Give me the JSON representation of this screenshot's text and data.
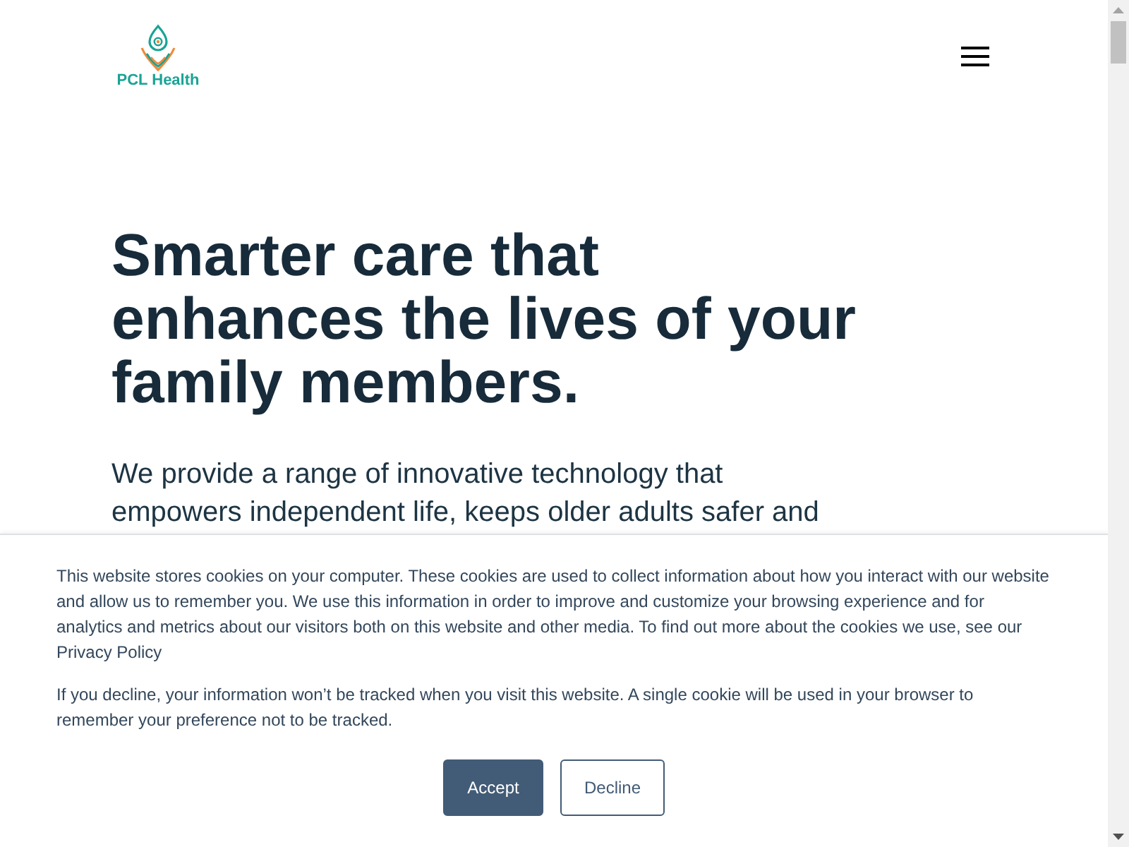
{
  "header": {
    "logo_text": "PCL Health"
  },
  "hero": {
    "heading": "Smarter care that enhances the lives of your family members.",
    "text": "We provide a range of innovative technology that empowers independent life, keeps older adults safer and"
  },
  "cookie_banner": {
    "paragraphs": [
      {
        "text": "This website stores cookies on your computer. These cookies are used to collect information about how you interact with our website and allow us to remember you. We use this information in order to improve and customize your browsing experience and for analytics and metrics about our visitors both on this website and other media. To find out more about the cookies we use, see our",
        "link": "Privacy Policy"
      },
      {
        "text": "If you decline, your information won’t be tracked when you visit this website. A single cookie will be used in your browser to remember your preference not to be tracked."
      }
    ],
    "buttons": [
      {
        "label": "Accept",
        "kind": "primary"
      },
      {
        "label": "Decline",
        "kind": "secondary"
      }
    ]
  }
}
